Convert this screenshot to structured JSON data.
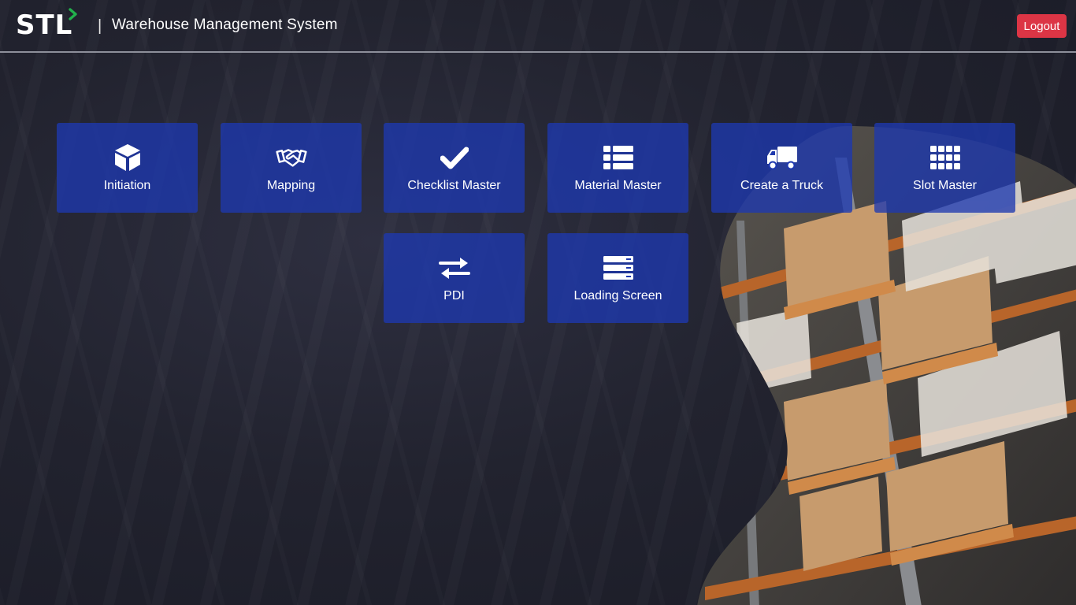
{
  "header": {
    "logo_text": "STL",
    "divider": "|",
    "title": "Warehouse Management System",
    "logout_label": "Logout"
  },
  "tiles": [
    {
      "label": "Initiation",
      "icon": "cube-icon"
    },
    {
      "label": "Mapping",
      "icon": "handshake-icon"
    },
    {
      "label": "Checklist Master",
      "icon": "check-icon"
    },
    {
      "label": "Material Master",
      "icon": "list-icon"
    },
    {
      "label": "Create a Truck",
      "icon": "truck-icon"
    },
    {
      "label": "Slot Master",
      "icon": "grid-icon"
    },
    {
      "label": "PDI",
      "icon": "exchange-arrows-icon"
    },
    {
      "label": "Loading Screen",
      "icon": "server-icon"
    }
  ],
  "colors": {
    "accent_tile": "#1e38af",
    "logout": "#dc3545",
    "logo_accent": "#22b14c",
    "background": "#1e1f2e"
  }
}
